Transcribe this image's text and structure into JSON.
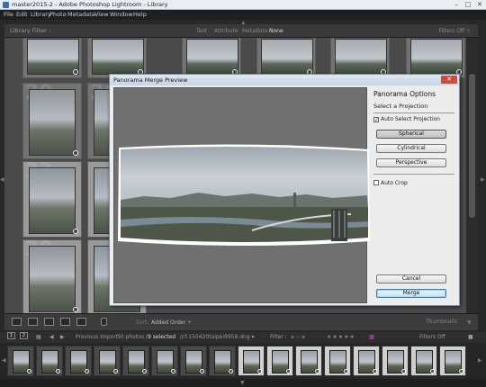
{
  "window": {
    "title": "master2015-2 - Adobe Photoshop Lightroom - Library"
  },
  "menu": [
    "File",
    "Edit",
    "Library",
    "Photo",
    "Metadata",
    "View",
    "Window",
    "Help"
  ],
  "library_filter": {
    "label": "Library Filter :",
    "options": [
      "Text",
      "Attribute",
      "Metadata",
      "None"
    ],
    "active": "None",
    "preset": "Filters Off ÷"
  },
  "grid": {
    "row_numbers": [
      "20",
      "26",
      "32",
      "38"
    ]
  },
  "dialog": {
    "title": "Panorama Merge Preview",
    "options_title": "Panorama Options",
    "projection_label": "Select a Projection",
    "auto_select": {
      "label": "Auto Select Projection",
      "checked": true
    },
    "projections": [
      "Spherical",
      "Cylindrical",
      "Perspective"
    ],
    "selected_projection": "Spherical",
    "auto_crop": {
      "label": "Auto Crop",
      "checked": false
    },
    "cancel_label": "Cancel",
    "merge_label": "Merge"
  },
  "toolbar": {
    "sort_label": "Sort:",
    "sort_value": "Added Order ÷",
    "thumbnails_label": "Thumbnails"
  },
  "filmstrip_header": {
    "view1": "1",
    "view2": "2",
    "source": "Previous Import",
    "count": "30 photos /",
    "selected": "9 selected",
    "filename": "/cf-150420taipei9958.dng ▾",
    "filter_label": "Filter :",
    "filters_off": "Filters Off"
  },
  "colors": {
    "dialog_bg": "#ececec",
    "grid_bg": "#4a4a4a",
    "accent": "#3c7fb1"
  }
}
